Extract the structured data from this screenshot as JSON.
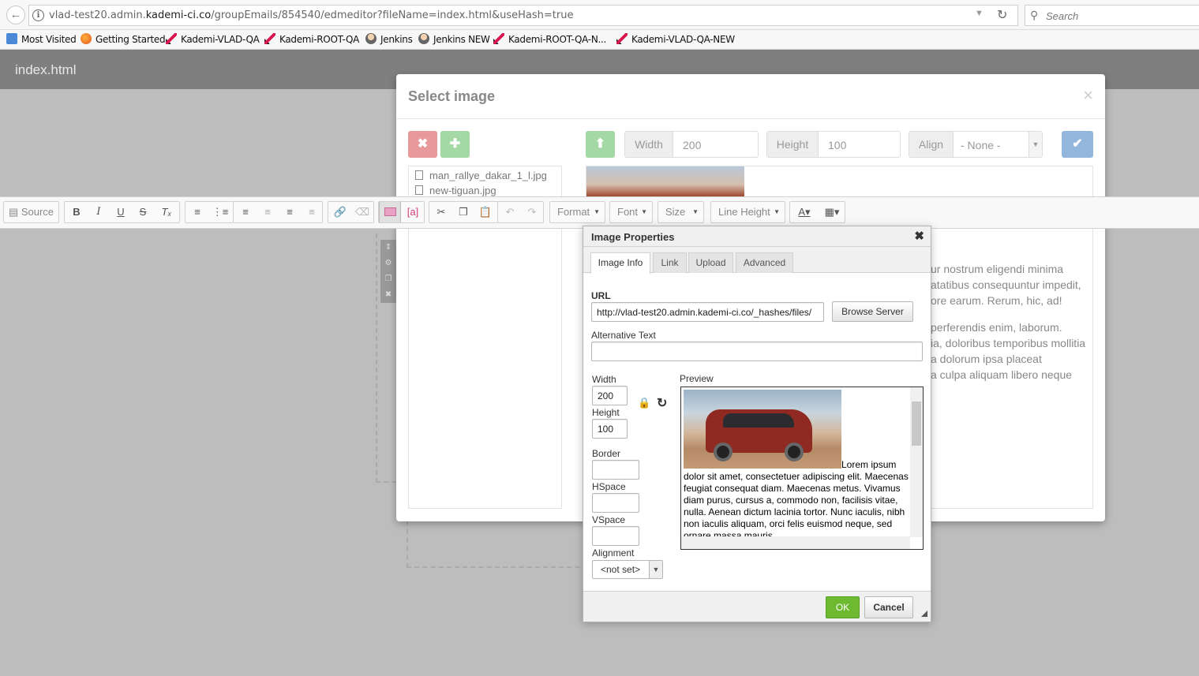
{
  "browser": {
    "url_prefix": "vlad-test20.admin.",
    "url_host": "kademi-ci.co",
    "url_path": "/groupEmails/854540/edmeditor?fileName=index.html&useHash=true",
    "search_placeholder": "Search",
    "bookmarks": [
      "Most Visited",
      "Getting Started",
      "Kademi-VLAD-QA",
      "Kademi-ROOT-QA",
      "Jenkins",
      "Jenkins NEW",
      "Kademi-ROOT-QA-N...",
      "Kademi-VLAD-QA-NEW"
    ]
  },
  "app": {
    "title": "index.html"
  },
  "select_image": {
    "title": "Select image",
    "close": "×",
    "width_label": "Width",
    "width_value": "200",
    "height_label": "Height",
    "height_value": "100",
    "align_label": "Align",
    "align_value": "- None -",
    "files": [
      "man_rallye_dakar_1_l.jpg",
      "new-tiguan.jpg"
    ],
    "bg_text": [
      "ur nostrum eligendi minima",
      "atatibus consequuntur impedit,",
      "ore earum. Rerum, hic, ad!",
      "perferendis enim, laborum.",
      "ia, doloribus temporibus mollitia",
      "a dolorum ipsa placeat",
      "a culpa aliquam libero neque"
    ]
  },
  "toolbar": {
    "source": "Source",
    "format": "Format",
    "font": "Font",
    "size": "Size",
    "line_height": "Line Height"
  },
  "image_props": {
    "title": "Image Properties",
    "tabs": [
      "Image Info",
      "Link",
      "Upload",
      "Advanced"
    ],
    "url_label": "URL",
    "url_value": "http://vlad-test20.admin.kademi-ci.co/_hashes/files/",
    "browse_server": "Browse Server",
    "alt_label": "Alternative Text",
    "alt_value": "",
    "width_label": "Width",
    "width_value": "200",
    "height_label": "Height",
    "height_value": "100",
    "border_label": "Border",
    "hspace_label": "HSpace",
    "vspace_label": "VSpace",
    "alignment_label": "Alignment",
    "alignment_value": "<not set>",
    "preview_label": "Preview",
    "preview_text_1": "Lorem ipsum",
    "preview_text_2": "dolor sit amet, consectetuer adipiscing elit. Maecenas feugiat consequat diam. Maecenas metus. Vivamus diam purus, cursus a, commodo non, facilisis vitae, nulla. Aenean dictum lacinia tortor. Nunc iaculis, nibh non iaculis aliquam, orci felis euismod neque, sed ornare massa mauris",
    "ok": "OK",
    "cancel": "Cancel"
  }
}
